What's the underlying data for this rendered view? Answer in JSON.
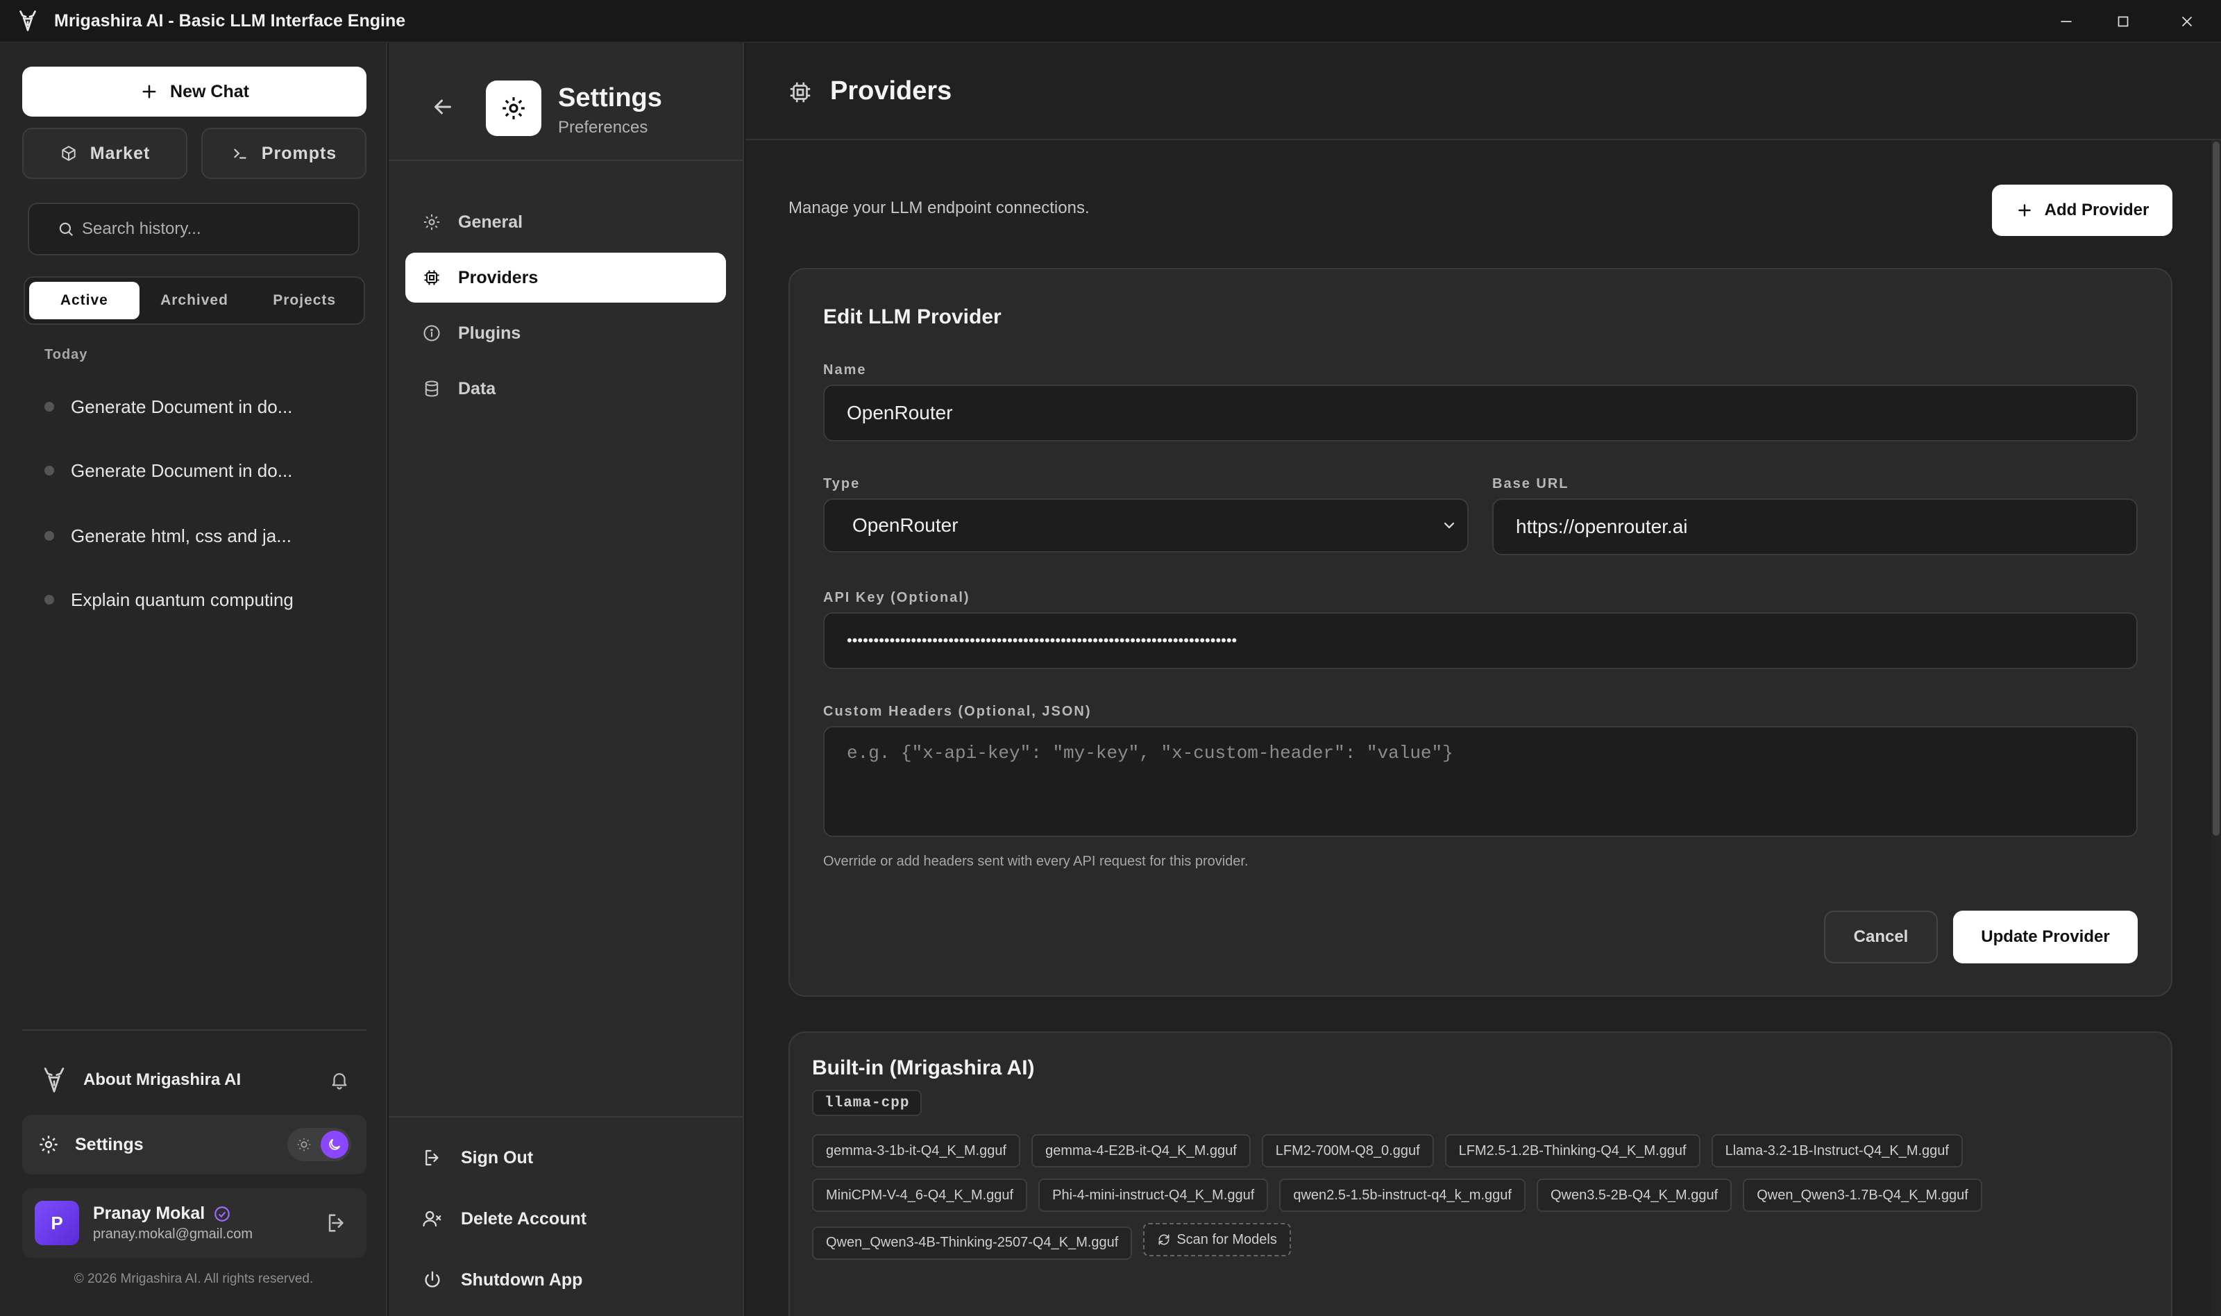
{
  "window": {
    "title": "Mrigashira AI - Basic LLM Interface Engine"
  },
  "sidebar": {
    "new_chat": "New Chat",
    "market": "Market",
    "prompts": "Prompts",
    "search_placeholder": "Search history...",
    "tabs": [
      "Active",
      "Archived",
      "Projects"
    ],
    "active_tab": "Active",
    "group_today": "Today",
    "history": [
      "Generate Document in do...",
      "Generate Document in do...",
      "Generate html, css and ja...",
      "Explain quantum computing"
    ],
    "about": "About Mrigashira AI",
    "settings": "Settings",
    "user": {
      "initial": "P",
      "name": "Pranay Mokal",
      "email": "pranay.mokal@gmail.com"
    },
    "copyright": "© 2026 Mrigashira AI. All rights reserved."
  },
  "settings_panel": {
    "title": "Settings",
    "subtitle": "Preferences",
    "nav": [
      "General",
      "Providers",
      "Plugins",
      "Data"
    ],
    "active_nav": "Providers",
    "footer": [
      "Sign Out",
      "Delete Account",
      "Shutdown App"
    ]
  },
  "main": {
    "title": "Providers",
    "description": "Manage your LLM endpoint connections.",
    "add_provider": "Add Provider",
    "edit": {
      "title": "Edit LLM Provider",
      "name_label": "Name",
      "name_value": "OpenRouter",
      "type_label": "Type",
      "type_value": "OpenRouter",
      "base_url_label": "Base URL",
      "base_url_value": "https://openrouter.ai",
      "api_key_label": "API Key (Optional)",
      "api_key_value": "•••••••••••••••••••••••••••••••••••••••••••••••••••••••••••••••••••••••••",
      "headers_label": "Custom Headers (Optional, JSON)",
      "headers_placeholder": "e.g. {\"x-api-key\": \"my-key\", \"x-custom-header\": \"value\"}",
      "headers_hint": "Override or add headers sent with every API request for this provider.",
      "cancel": "Cancel",
      "update": "Update Provider"
    },
    "builtin": {
      "title": "Built-in (Mrigashira AI)",
      "engine": "llama-cpp",
      "models": [
        "gemma-3-1b-it-Q4_K_M.gguf",
        "gemma-4-E2B-it-Q4_K_M.gguf",
        "LFM2-700M-Q8_0.gguf",
        "LFM2.5-1.2B-Thinking-Q4_K_M.gguf",
        "Llama-3.2-1B-Instruct-Q4_K_M.gguf",
        "MiniCPM-V-4_6-Q4_K_M.gguf",
        "Phi-4-mini-instruct-Q4_K_M.gguf",
        "qwen2.5-1.5b-instruct-q4_k_m.gguf",
        "Qwen3.5-2B-Q4_K_M.gguf",
        "Qwen_Qwen3-1.7B-Q4_K_M.gguf",
        "Qwen_Qwen3-4B-Thinking-2507-Q4_K_M.gguf"
      ],
      "scan": "Scan for Models"
    }
  },
  "colors": {
    "accent": "#8b47ff",
    "background": "#212121",
    "surface": "#2a2a2a"
  }
}
